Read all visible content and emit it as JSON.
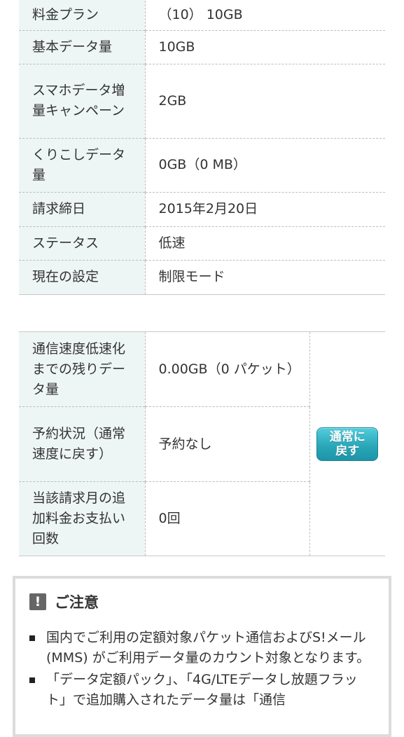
{
  "table1": {
    "partial_label": "料金プラン",
    "partial_value": "（10） 10GB",
    "rows": [
      {
        "label": "基本データ量",
        "value": "10GB"
      },
      {
        "label": "スマホデータ増量キャンペーン",
        "value": "2GB"
      },
      {
        "label": "くりこしデータ量",
        "value": "0GB（0 MB）"
      },
      {
        "label": "請求締日",
        "value": "2015年2月20日"
      },
      {
        "label": "ステータス",
        "value": "低速"
      },
      {
        "label": "現在の設定",
        "value": "制限モード"
      }
    ]
  },
  "table2": {
    "rows": [
      {
        "label": "通信速度低速化までの残りデータ量",
        "value": "0.00GB（0 パケット）"
      },
      {
        "label": "予約状況（通常速度に戻す）",
        "value": "予約なし"
      },
      {
        "label": "当該請求月の追加料金お支払い回数",
        "value": "0回"
      }
    ],
    "button_line1": "通常に",
    "button_line2": "戻す"
  },
  "notice": {
    "icon_text": "!",
    "title": "ご注意",
    "items": [
      "国内でご利用の定額対象パケット通信およびS!メール(MMS) がご利用データ量のカウント対象となります。",
      "「データ定額パック」、「4G/LTEデータし放題フラット」で追加購入されたデータ量は「通信"
    ]
  },
  "colors": {
    "label_bg": "#eef5f5",
    "button": "#2aa7b9",
    "border": "#bdbdbd"
  }
}
